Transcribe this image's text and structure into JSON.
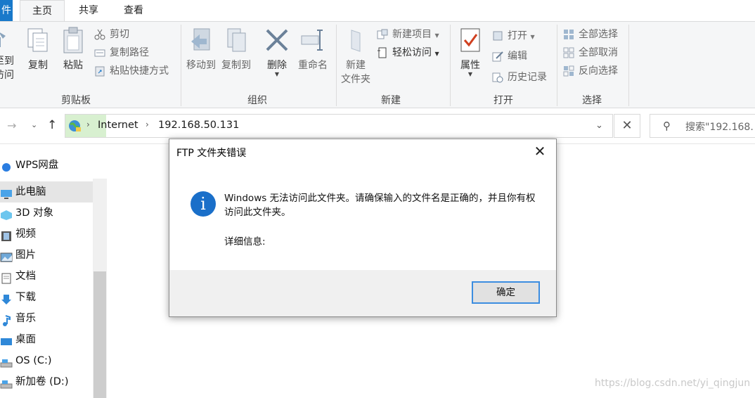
{
  "tabs": [
    {
      "label": "件"
    },
    {
      "label": "主页"
    },
    {
      "label": "共享"
    },
    {
      "label": "查看"
    }
  ],
  "ribbon": {
    "clipboard": {
      "group": "剪贴板",
      "pin": "至到\n访问",
      "copy": "复制",
      "paste": "粘贴",
      "cut": "剪切",
      "copy_path": "复制路径",
      "paste_shortcut": "粘贴快捷方式"
    },
    "organize": {
      "group": "组织",
      "move_to": "移动到",
      "copy_to": "复制到",
      "delete": "删除",
      "rename": "重命名"
    },
    "new": {
      "group": "新建",
      "new_folder": "新建\n文件夹",
      "new_item": "新建项目",
      "easy_access": "轻松访问"
    },
    "open": {
      "group": "打开",
      "properties": "属性",
      "open": "打开",
      "edit": "编辑",
      "history": "历史记录"
    },
    "select": {
      "group": "选择",
      "select_all": "全部选择",
      "select_none": "全部取消",
      "invert": "反向选择"
    }
  },
  "address": {
    "crumbs": [
      "Internet",
      "192.168.50.131"
    ],
    "search_placeholder": "搜索\"192.168."
  },
  "sidebar": {
    "items": [
      {
        "label": "WPS网盘",
        "icon": "cloud-icon"
      },
      {
        "label": "此电脑",
        "icon": "computer-icon"
      },
      {
        "label": "3D 对象",
        "icon": "cube-icon"
      },
      {
        "label": "视频",
        "icon": "film-icon"
      },
      {
        "label": "图片",
        "icon": "picture-icon"
      },
      {
        "label": "文档",
        "icon": "document-icon"
      },
      {
        "label": "下载",
        "icon": "download-icon"
      },
      {
        "label": "音乐",
        "icon": "music-icon"
      },
      {
        "label": "桌面",
        "icon": "desktop-icon"
      },
      {
        "label": "OS (C:)",
        "icon": "drive-icon"
      },
      {
        "label": "新加卷 (D:)",
        "icon": "drive-icon"
      }
    ]
  },
  "dialog": {
    "title": "FTP 文件夹错误",
    "message": "Windows 无法访问此文件夹。请确保输入的文件名是正确的，并且你有权访问此文件夹。",
    "details_label": "详细信息:",
    "ok_label": "确定"
  },
  "watermark": "https://blog.csdn.net/yi_qingjun",
  "colors": {
    "accent": "#1979ca",
    "info": "#1a6fc9",
    "ok_border": "#3c8de0"
  }
}
